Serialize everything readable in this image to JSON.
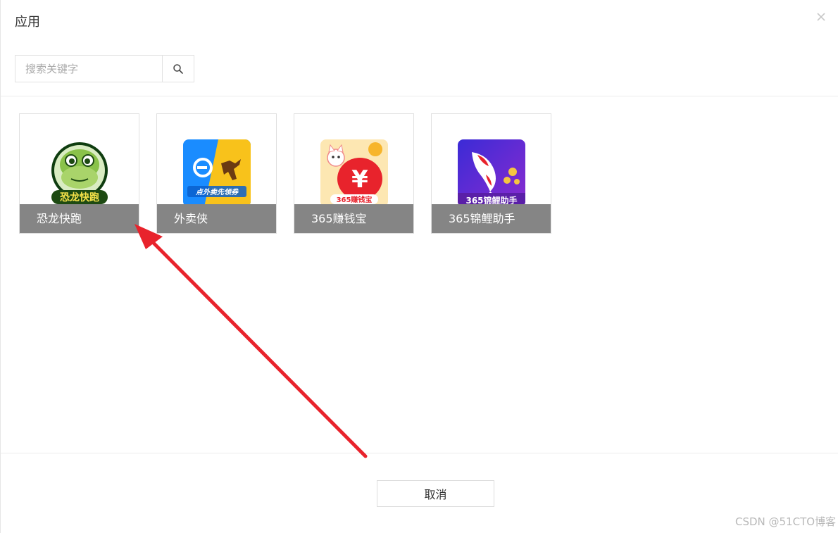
{
  "dialog": {
    "title": "应用",
    "close_glyph": "×"
  },
  "search": {
    "placeholder": "搜索关键字",
    "value": "",
    "button_icon": "search-icon"
  },
  "apps": [
    {
      "name": "恐龙快跑",
      "icon": "dinosaur-app-icon",
      "icon_text": "恐龙快跑",
      "accent": "#7cc242"
    },
    {
      "name": "外卖侠",
      "icon": "kangaroo-app-icon",
      "icon_text": "点外卖先领券",
      "accent": "#1a8cff"
    },
    {
      "name": "365赚钱宝",
      "icon": "lucky-cat-app-icon",
      "icon_text": "365赚钱宝",
      "accent": "#e8232c"
    },
    {
      "name": "365锦鲤助手",
      "icon": "koi-fish-app-icon",
      "icon_text": "365锦鲤助手",
      "accent": "#6a2fd0"
    }
  ],
  "footer": {
    "cancel_label": "取消"
  },
  "annotation": {
    "arrow_color": "#e8232c",
    "arrow_icon": "red-arrow-icon"
  },
  "watermark": "CSDN @51CTO博客"
}
